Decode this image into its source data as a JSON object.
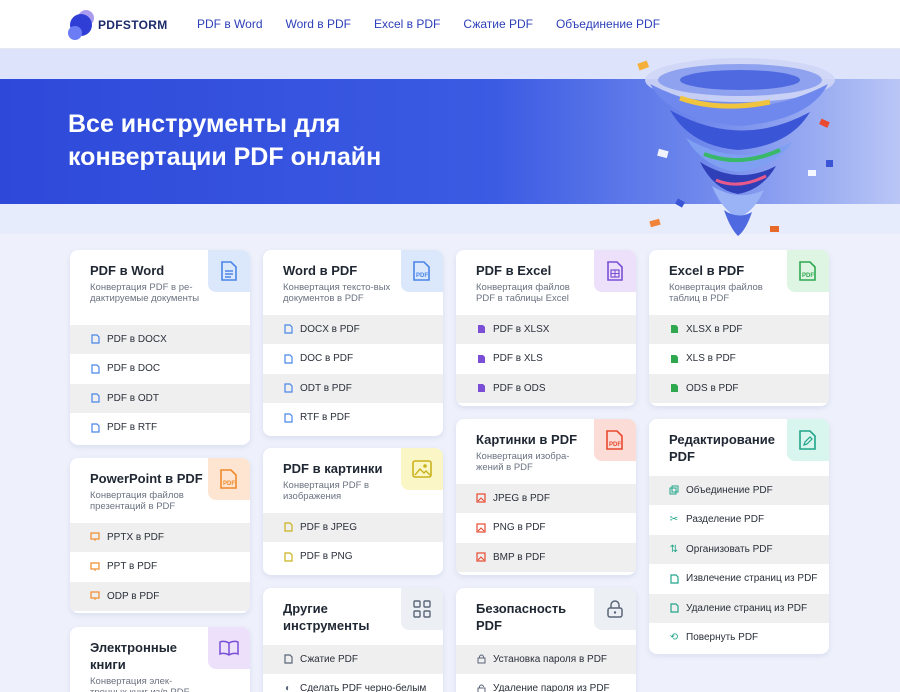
{
  "header": {
    "logo": "PDFSTORM",
    "nav": [
      "PDF в Word",
      "Word в PDF",
      "Excel в PDF",
      "Сжатие PDF",
      "Объединение PDF"
    ]
  },
  "hero": {
    "title": "Все инструменты для конвертации PDF онлайн"
  },
  "colors": {
    "word": "#4a86e8",
    "excel": "#2fa84f",
    "pdf": "#e8492f",
    "purple": "#7a4fd6",
    "orange": "#f08a2a",
    "yellow": "#c9b21c"
  },
  "cards": {
    "pdf_word": {
      "title": "PDF в Word",
      "desc": "Конвертация PDF в ре-дактируемые документы",
      "items": [
        "PDF в DOCX",
        "PDF в DOC",
        "PDF в ODT",
        "PDF в RTF"
      ]
    },
    "word_pdf": {
      "title": "Word в PDF",
      "desc": "Конвертация тексто-вых документов в PDF",
      "items": [
        "DOCX в PDF",
        "DOC в PDF",
        "ODT в PDF",
        "RTF в PDF"
      ]
    },
    "pdf_excel": {
      "title": "PDF в Excel",
      "desc": "Конвертация файлов PDF в таблицы Excel",
      "items": [
        "PDF в XLSX",
        "PDF в XLS",
        "PDF в ODS"
      ]
    },
    "excel_pdf": {
      "title": "Excel в PDF",
      "desc": "Конвертация файлов таблиц в PDF",
      "items": [
        "XLSX в PDF",
        "XLS в PDF",
        "ODS в PDF"
      ]
    },
    "ppt_pdf": {
      "title": "PowerPoint в PDF",
      "desc": "Конвертация файлов презентаций в PDF",
      "items": [
        "PPTX в PDF",
        "PPT в PDF",
        "ODP в PDF"
      ]
    },
    "pdf_img": {
      "title": "PDF в картинки",
      "desc": "Конвертация PDF в изображения",
      "items": [
        "PDF в JPEG",
        "PDF в PNG"
      ]
    },
    "img_pdf": {
      "title": "Картинки в PDF",
      "desc": "Конвертация изобра-жений в PDF",
      "items": [
        "JPEG в PDF",
        "PNG в PDF",
        "BMP в PDF"
      ]
    },
    "edit_pdf": {
      "title": "Редактирование PDF",
      "items": [
        "Объединение PDF",
        "Разделение PDF",
        "Организовать PDF",
        "Извлечение страниц из PDF",
        "Удаление страниц из PDF",
        "Повернуть PDF"
      ]
    },
    "ebooks": {
      "title": "Электронные книги",
      "desc": "Конвертация элек-тронных книг из/в PDF"
    },
    "other": {
      "title": "Другие инструменты",
      "items": [
        "Сжатие PDF",
        "Сделать PDF черно-белым"
      ]
    },
    "security": {
      "title": "Безопасность PDF",
      "items": [
        "Установка пароля в PDF",
        "Удаление пароля из PDF"
      ]
    }
  }
}
